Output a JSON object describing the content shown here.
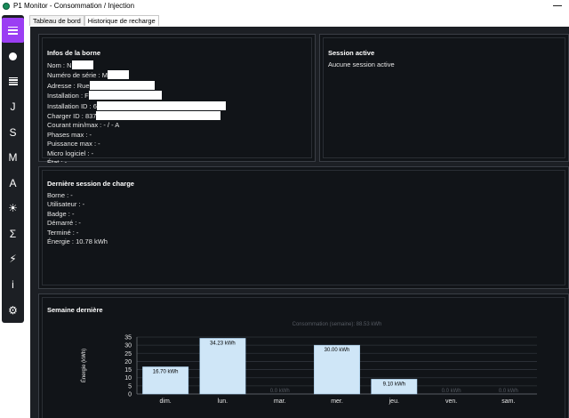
{
  "window": {
    "title": "P1 Monitor - Consommation / Injection"
  },
  "sidebar": {
    "items": [
      {
        "glyph": "☰",
        "icon": "menu-icon"
      },
      {
        "glyph": "●",
        "icon": "realtime-dot-icon"
      },
      {
        "glyph": "▤",
        "icon": "table-icon"
      },
      {
        "glyph": "J",
        "icon": "day-icon"
      },
      {
        "glyph": "S",
        "icon": "week-icon"
      },
      {
        "glyph": "M",
        "icon": "month-icon"
      },
      {
        "glyph": "A",
        "icon": "year-icon"
      },
      {
        "glyph": "☀",
        "icon": "solar-icon"
      },
      {
        "glyph": "Σ",
        "icon": "sum-icon"
      },
      {
        "glyph": "⚡",
        "icon": "lightning-icon"
      },
      {
        "glyph": "i",
        "icon": "info-icon"
      },
      {
        "glyph": "⚙",
        "icon": "gear-icon"
      }
    ]
  },
  "tabs": [
    "Tableau de bord",
    "Historique de recharge"
  ],
  "station": {
    "title": "Infos de la borne",
    "name_label": "Nom : ",
    "name_value": "N",
    "serial_label": "Numéro de série : ",
    "serial_value": "M",
    "address_label": "Adresse : ",
    "address_value": "Rue",
    "install_label": "Installation : ",
    "install_value": "F",
    "install_id_label": "Installation ID : ",
    "install_id_value": "6",
    "charger_id_label": "Charger ID : ",
    "charger_id_value": "837",
    "current": "Courant min/max : - / - A",
    "phases": "Phases max : -",
    "power": "Puissance max : -",
    "firmware": "Micro logiciel : -",
    "state": "État : -"
  },
  "session": {
    "title": "Session active",
    "text": "Aucune session active"
  },
  "last_session": {
    "title": "Dernière session de charge",
    "lines": [
      "Borne : -",
      "Utilisateur : -",
      "Badge : -",
      "Démarré : -",
      "Terminé : -",
      "Énergie : 10.78 kWh"
    ]
  },
  "week": {
    "title": "Semaine dernière"
  },
  "chart_data": {
    "type": "bar",
    "title": "Consommation (semaine): 88.53 kWh",
    "ylabel": "Énergie (kWh)",
    "categories": [
      "dim.",
      "lun.",
      "mar.",
      "mer.",
      "jeu.",
      "ven.",
      "sam."
    ],
    "values": [
      16.7,
      34.23,
      0,
      30.0,
      9.1,
      0,
      0
    ],
    "labels": [
      "16.70 kWh",
      "34.23 kWh",
      "0.0 kWh",
      "30.00 kWh",
      "9.10 kWh",
      "0.0 kWh",
      "0.0 kWh"
    ],
    "ylim": [
      0,
      35
    ],
    "yticks": [
      0,
      5,
      10,
      15,
      20,
      25,
      30,
      35
    ],
    "grid": true,
    "bar_color": "#cfe6f7",
    "label_color": "#000000",
    "faint_label_color": "#555a62"
  }
}
